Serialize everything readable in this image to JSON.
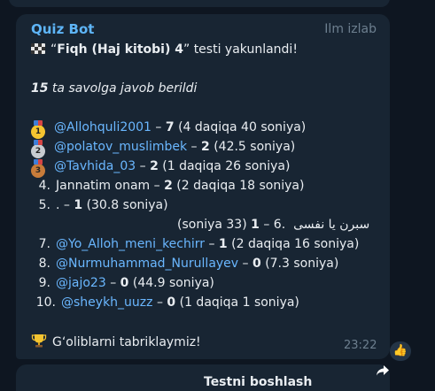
{
  "message": {
    "sender": "Quiz Bot",
    "via": "Ilm izlab",
    "title_quote_open": "“",
    "title_name": "Fiqh (Haj kitobi) 4",
    "title_rest": "” testi yakunlandi!",
    "answered_count": "15",
    "answered_text": " ta savolga javob berildi",
    "results": [
      {
        "rank": "1",
        "user": "@Allohquli2001",
        "score": "7",
        "time": "(4 daqiqa 40 soniya)"
      },
      {
        "rank": "2",
        "user": "@polatov_muslimbek",
        "score": "2",
        "time": "(42.5 soniya)"
      },
      {
        "rank": "3",
        "user": "@Tavhida_03",
        "score": "2",
        "time": "(1 daqiqa 26 soniya)"
      },
      {
        "rank": "4.",
        "user": "Jannatim onam",
        "score": "2",
        "time": "(2 daqiqa 18 soniya)"
      },
      {
        "rank": "5.",
        "user": ".",
        "score": "1",
        "time": "(30.8 soniya)"
      },
      {
        "rank": ".6",
        "user": "سبرن يا نفسى",
        "score": "1",
        "time": "(soniya 33)"
      },
      {
        "rank": "7.",
        "user": "@Yo_Alloh_meni_kechirr",
        "score": "1",
        "time": "(2 daqiqa 16 soniya)"
      },
      {
        "rank": "8.",
        "user": "@Nurmuhammad_Nurullayev",
        "score": "0",
        "time": "(7.3 soniya)"
      },
      {
        "rank": "9.",
        "user": "@jajo23",
        "score": "0",
        "time": "(44.9 soniya)"
      },
      {
        "rank": "10.",
        "user": "@sheykh_uuzz",
        "score": "0",
        "time": "(1 daqiqa 1 soniya)"
      }
    ],
    "dash": " – ",
    "congrats": "G‘oliblarni tabriklaymiz!",
    "timestamp": "23:22",
    "reaction": "👍"
  },
  "next_message": {
    "partial_text": "Testni boshlash"
  },
  "colors": {
    "background": "#0e1621",
    "bubble": "#182533",
    "accent": "#5eb5f7",
    "mention": "#6ab7ff"
  },
  "icons": [
    "checkered-flag-icon",
    "gold-medal-icon",
    "silver-medal-icon",
    "bronze-medal-icon",
    "trophy-icon",
    "share-icon",
    "thumbs-up-icon"
  ]
}
